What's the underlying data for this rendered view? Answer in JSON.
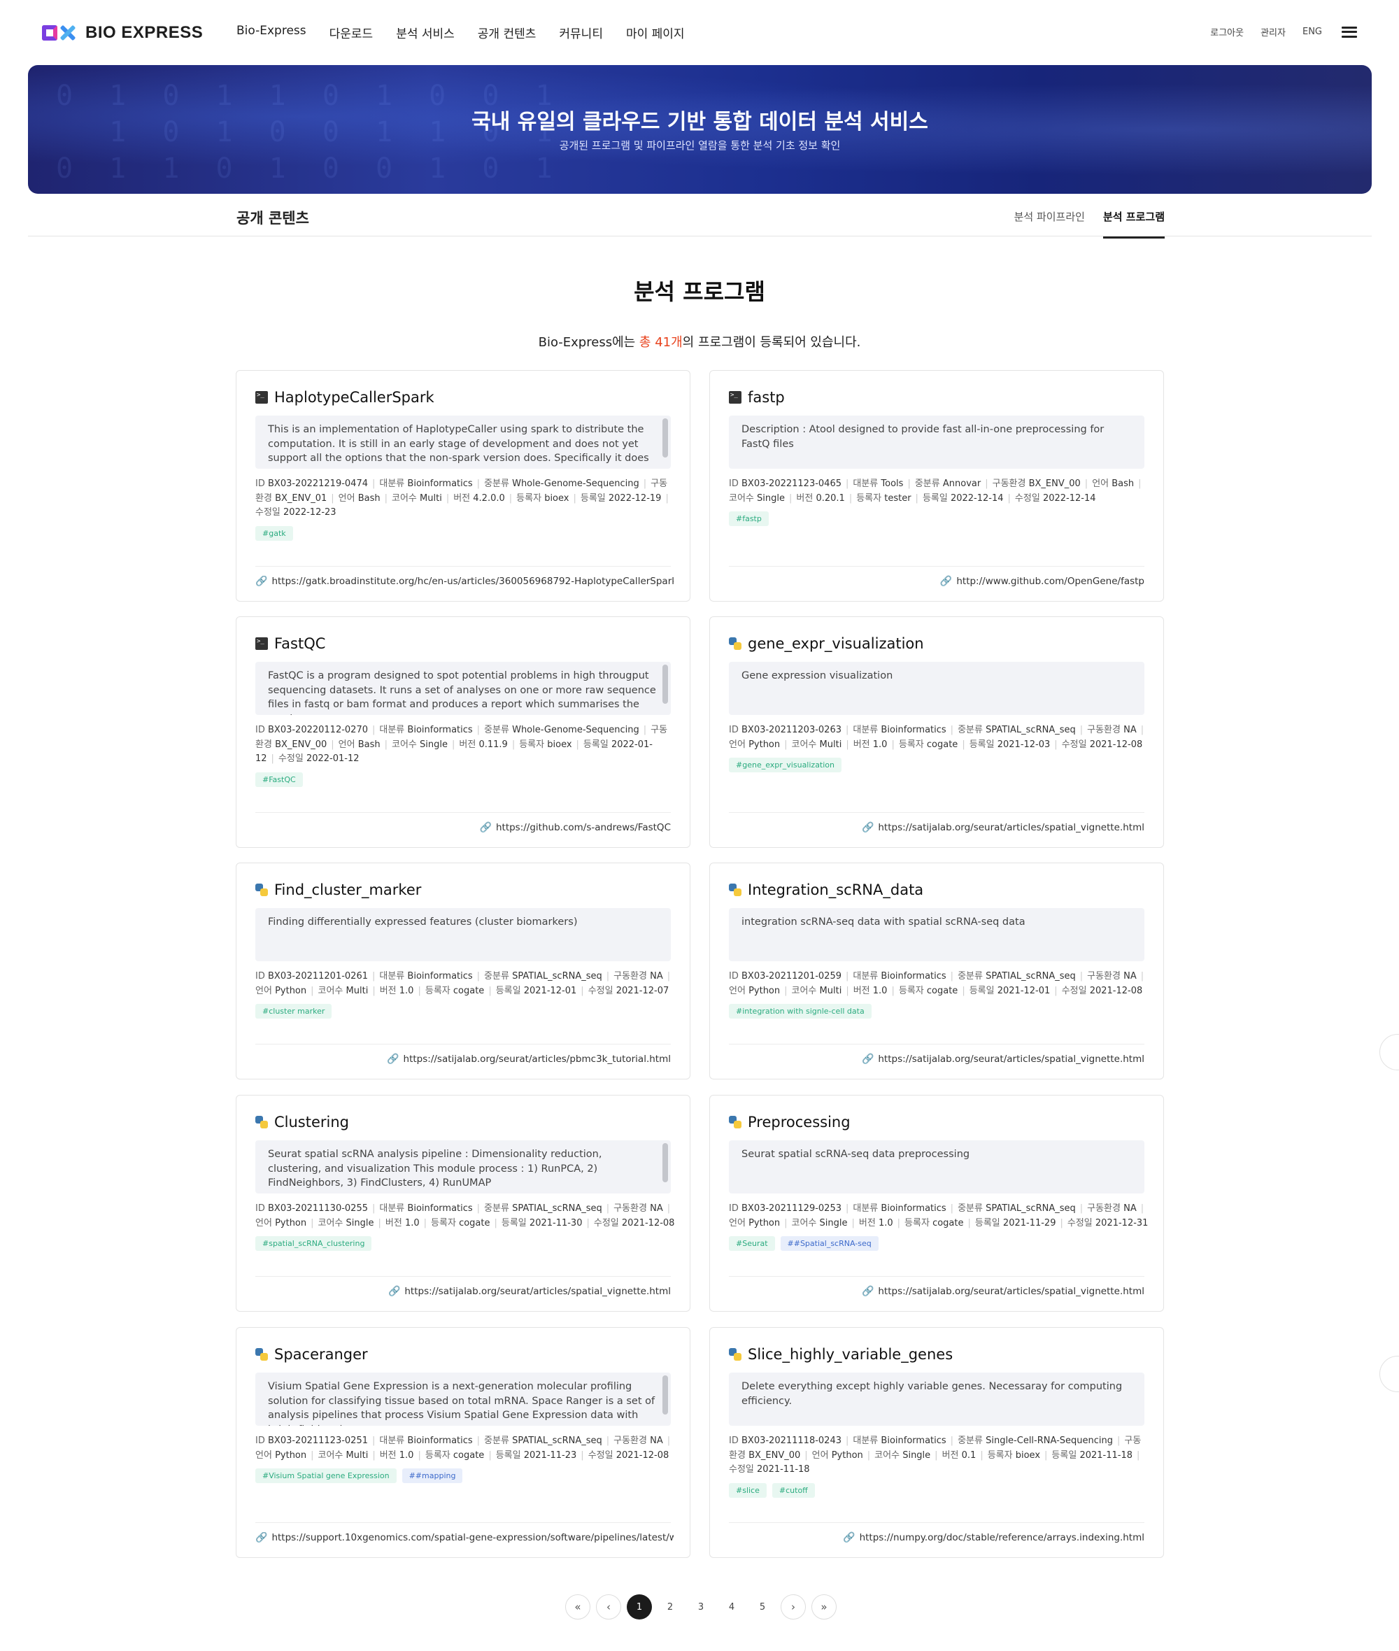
{
  "header": {
    "logo_text": "BIO EXPRESS",
    "nav": [
      "Bio-Express",
      "다운로드",
      "분석 서비스",
      "공개 컨텐츠",
      "커뮤니티",
      "마이 페이지"
    ],
    "util": {
      "logout": "로그아웃",
      "admin": "관리자",
      "lang": "ENG"
    }
  },
  "hero": {
    "title": "국내 유일의 클라우드 기반 통합 데이터 분석 서비스",
    "subtitle": "공개된 프로그램 및 파이프라인 열람을 통한 분석 기초 정보 확인"
  },
  "section": {
    "title": "공개 콘텐츠",
    "tabs": [
      "분석 파이프라인",
      "분석 프로그램"
    ],
    "active_tab": "분석 프로그램"
  },
  "page": {
    "heading": "분석 프로그램",
    "summary_prefix": "Bio-Express에는 ",
    "summary_count": "총 41개",
    "summary_suffix": "의 프로그램이 등록되어 있습니다."
  },
  "labels": {
    "id": "ID",
    "major": "대분류",
    "middle": "중분류",
    "env": "구동환경",
    "lang": "언어",
    "cores": "코어수",
    "version": "버전",
    "registrant": "등록자",
    "reg_date": "등록일",
    "mod_date": "수정일"
  },
  "cards": [
    {
      "icon": "terminal-icon",
      "title": "HaplotypeCallerSpark",
      "desc": "This is an implementation of HaplotypeCaller using spark to distribute the computation. It is still in an early stage of development and does not yet support all the options that the non-spark version does. Specifically it does not",
      "id": "BX03-20221219-0474",
      "major": "Bioinformatics",
      "middle": "Whole-Genome-Sequencing",
      "env": "BX_ENV_01",
      "lang": "Bash",
      "cores": "Multi",
      "version": "4.2.0.0",
      "registrant": "bioex",
      "reg_date": "2022-12-19",
      "mod_date": "2022-12-23",
      "tags": [
        "#gatk"
      ],
      "url": "https://gatk.broadinstitute.org/hc/en-us/articles/360056968792-HaplotypeCallerSpark-BETA-"
    },
    {
      "icon": "terminal-icon",
      "title": "fastp",
      "desc": "Description : Atool designed to provide fast all-in-one preprocessing for FastQ files",
      "id": "BX03-20221123-0465",
      "major": "Tools",
      "middle": "Annovar",
      "env": "BX_ENV_00",
      "lang": "Bash",
      "cores": "Single",
      "version": "0.20.1",
      "registrant": "tester",
      "reg_date": "2022-12-14",
      "mod_date": "2022-12-14",
      "tags": [
        "#fastp"
      ],
      "url": "http://www.github.com/OpenGene/fastp"
    },
    {
      "icon": "terminal-icon",
      "title": "FastQC",
      "desc": "FastQC is a program designed to spot potential problems in high througput sequencing datasets. It runs a set of analyses on one or more raw sequence files in fastq or bam format and produces a report which summarises the results.",
      "id": "BX03-20220112-0270",
      "major": "Bioinformatics",
      "middle": "Whole-Genome-Sequencing",
      "env": "BX_ENV_00",
      "lang": "Bash",
      "cores": "Single",
      "version": "0.11.9",
      "registrant": "bioex",
      "reg_date": "2022-01-12",
      "mod_date": "2022-01-12",
      "tags": [
        "#FastQC"
      ],
      "url": "https://github.com/s-andrews/FastQC"
    },
    {
      "icon": "python-icon",
      "title": "gene_expr_visualization",
      "desc": "Gene expression visualization",
      "id": "BX03-20211203-0263",
      "major": "Bioinformatics",
      "middle": "SPATIAL_scRNA_seq",
      "env": "NA",
      "lang": "Python",
      "cores": "Multi",
      "version": "1.0",
      "registrant": "cogate",
      "reg_date": "2021-12-03",
      "mod_date": "2021-12-08",
      "tags": [
        "#gene_expr_visualization"
      ],
      "url": "https://satijalab.org/seurat/articles/spatial_vignette.html"
    },
    {
      "icon": "python-icon",
      "title": "Find_cluster_marker",
      "desc": "Finding differentially expressed features (cluster biomarkers)",
      "id": "BX03-20211201-0261",
      "major": "Bioinformatics",
      "middle": "SPATIAL_scRNA_seq",
      "env": "NA",
      "lang": "Python",
      "cores": "Multi",
      "version": "1.0",
      "registrant": "cogate",
      "reg_date": "2021-12-01",
      "mod_date": "2021-12-07",
      "tags": [
        "#cluster marker"
      ],
      "url": "https://satijalab.org/seurat/articles/pbmc3k_tutorial.html"
    },
    {
      "icon": "python-icon",
      "title": "Integration_scRNA_data",
      "desc": "integration scRNA-seq data with spatial scRNA-seq data",
      "id": "BX03-20211201-0259",
      "major": "Bioinformatics",
      "middle": "SPATIAL_scRNA_seq",
      "env": "NA",
      "lang": "Python",
      "cores": "Multi",
      "version": "1.0",
      "registrant": "cogate",
      "reg_date": "2021-12-01",
      "mod_date": "2021-12-08",
      "tags": [
        "#integration with signle-cell data"
      ],
      "url": "https://satijalab.org/seurat/articles/spatial_vignette.html"
    },
    {
      "icon": "python-icon",
      "title": "Clustering",
      "desc": "Seurat spatial scRNA analysis pipeline : Dimensionality reduction, clustering, and visualization This module process : 1) RunPCA, 2) FindNeighbors, 3) FindClusters, 4) RunUMAP",
      "id": "BX03-20211130-0255",
      "major": "Bioinformatics",
      "middle": "SPATIAL_scRNA_seq",
      "env": "NA",
      "lang": "Python",
      "cores": "Single",
      "version": "1.0",
      "registrant": "cogate",
      "reg_date": "2021-11-30",
      "mod_date": "2021-12-08",
      "tags": [
        "#spatial_scRNA_clustering"
      ],
      "url": "https://satijalab.org/seurat/articles/spatial_vignette.html"
    },
    {
      "icon": "python-icon",
      "title": "Preprocessing",
      "desc": "Seurat spatial scRNA-seq data preprocessing",
      "id": "BX03-20211129-0253",
      "major": "Bioinformatics",
      "middle": "SPATIAL_scRNA_seq",
      "env": "NA",
      "lang": "Python",
      "cores": "Single",
      "version": "1.0",
      "registrant": "cogate",
      "reg_date": "2021-11-29",
      "mod_date": "2021-12-31",
      "tags": [
        "#Seurat",
        "##Spatial_scRNA-seq"
      ],
      "url": "https://satijalab.org/seurat/articles/spatial_vignette.html"
    },
    {
      "icon": "python-icon",
      "title": "Spaceranger",
      "desc": "Visium Spatial Gene Expression is a next-generation molecular profiling solution for classifying tissue based on total mRNA. Space Ranger is a set of analysis pipelines that process Visium Spatial Gene Expression data with brightfield and",
      "id": "BX03-20211123-0251",
      "major": "Bioinformatics",
      "middle": "SPATIAL_scRNA_seq",
      "env": "NA",
      "lang": "Python",
      "cores": "Multi",
      "version": "1.0",
      "registrant": "cogate",
      "reg_date": "2021-11-23",
      "mod_date": "2021-12-08",
      "tags": [
        "#Visium Spatial gene Expression",
        "##mapping"
      ],
      "url": "https://support.10xgenomics.com/spatial-gene-expression/software/pipelines/latest/what-is-space-ranger"
    },
    {
      "icon": "python-icon",
      "title": "Slice_highly_variable_genes",
      "desc": "Delete everything except highly variable genes. Necessaray for computing efficiency.",
      "id": "BX03-20211118-0243",
      "major": "Bioinformatics",
      "middle": "Single-Cell-RNA-Sequencing",
      "env": "BX_ENV_00",
      "lang": "Python",
      "cores": "Single",
      "version": "0.1",
      "registrant": "bioex",
      "reg_date": "2021-11-18",
      "mod_date": "2021-11-18",
      "tags": [
        "#slice",
        "#cutoff"
      ],
      "url": "https://numpy.org/doc/stable/reference/arrays.indexing.html"
    }
  ],
  "pagination": {
    "pages": [
      "1",
      "2",
      "3",
      "4",
      "5"
    ],
    "current": "1"
  }
}
